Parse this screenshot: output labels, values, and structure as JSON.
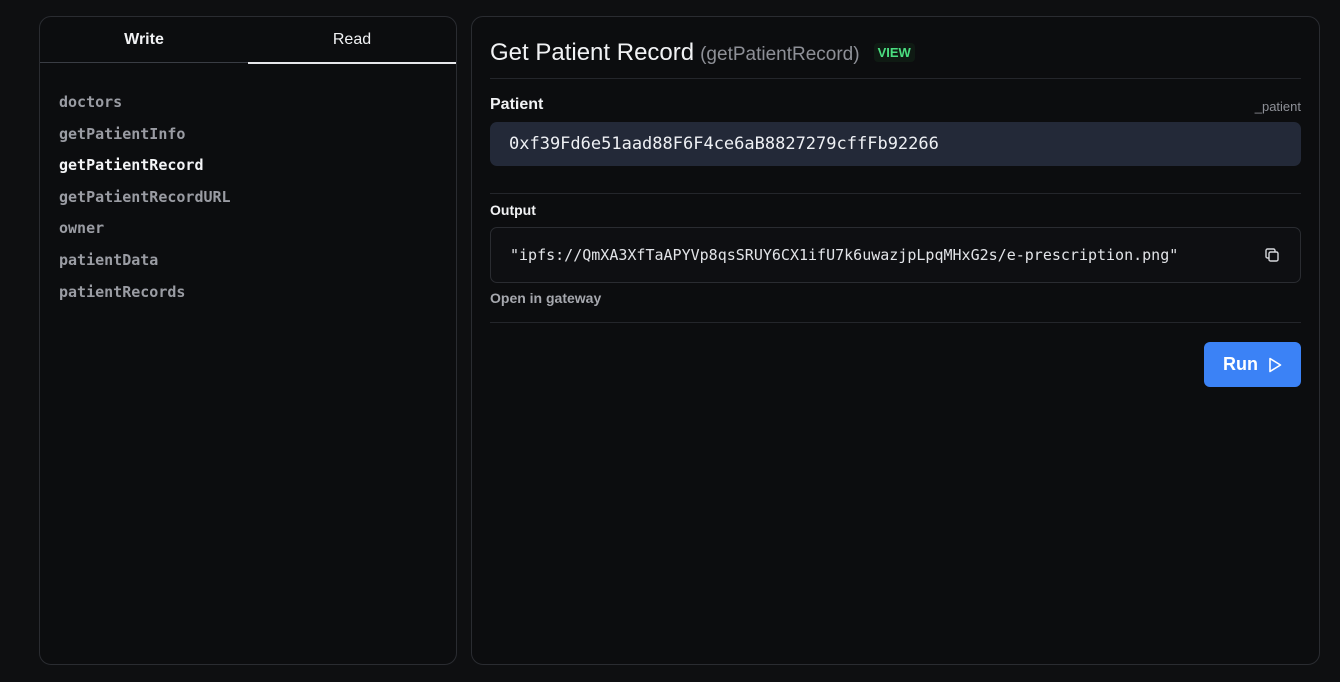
{
  "tabs": {
    "write": "Write",
    "read": "Read"
  },
  "functions": [
    "doctors",
    "getPatientInfo",
    "getPatientRecord",
    "getPatientRecordURL",
    "owner",
    "patientData",
    "patientRecords"
  ],
  "selected_function": "getPatientRecord",
  "header": {
    "title": "Get Patient Record",
    "subtitle": "(getPatientRecord)",
    "badge": "VIEW"
  },
  "input": {
    "label": "Patient",
    "param_name": "_patient",
    "value": "0xf39Fd6e51aad88F6F4ce6aB8827279cffFb92266"
  },
  "output": {
    "label": "Output",
    "value": "\"ipfs://QmXA3XfTaAPYVp8qsSRUY6CX1ifU7k6uwazjpLpqMHxG2s/e-prescription.png\"",
    "gateway_link": "Open in gateway"
  },
  "run_button": "Run",
  "colors": {
    "accent": "#3b82f6",
    "badge": "#4ade80",
    "input_bg": "#232938"
  }
}
